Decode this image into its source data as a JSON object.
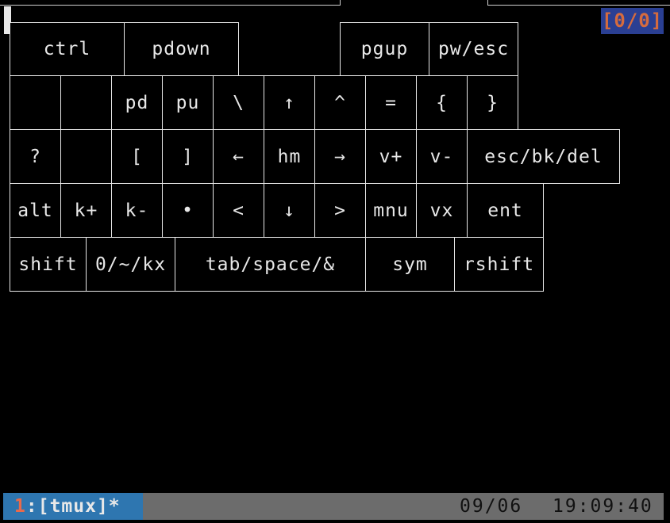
{
  "pane_counter": "[0/0]",
  "keyboard": {
    "row1": [
      "ctrl",
      "pdown",
      "pgup",
      "pw/esc"
    ],
    "row2": [
      "",
      "",
      "pd",
      "pu",
      "\\",
      "↑",
      "^",
      "=",
      "{",
      "}"
    ],
    "row3": [
      "?",
      "",
      "[",
      "]",
      "←",
      "hm",
      "→",
      "v+",
      "v-",
      "esc/bk/del"
    ],
    "row4": [
      "alt",
      "k+",
      "k-",
      "•",
      "<",
      "↓",
      ">",
      "mnu",
      "vx",
      "ent"
    ],
    "row5": [
      "shift",
      "0/~/kx",
      "tab/space/&",
      "sym",
      "rshift"
    ]
  },
  "status": {
    "window_index": "1",
    "window_sep": ":",
    "window_name": "[tmux]*",
    "date": "09/06",
    "time": "19:09:40"
  }
}
